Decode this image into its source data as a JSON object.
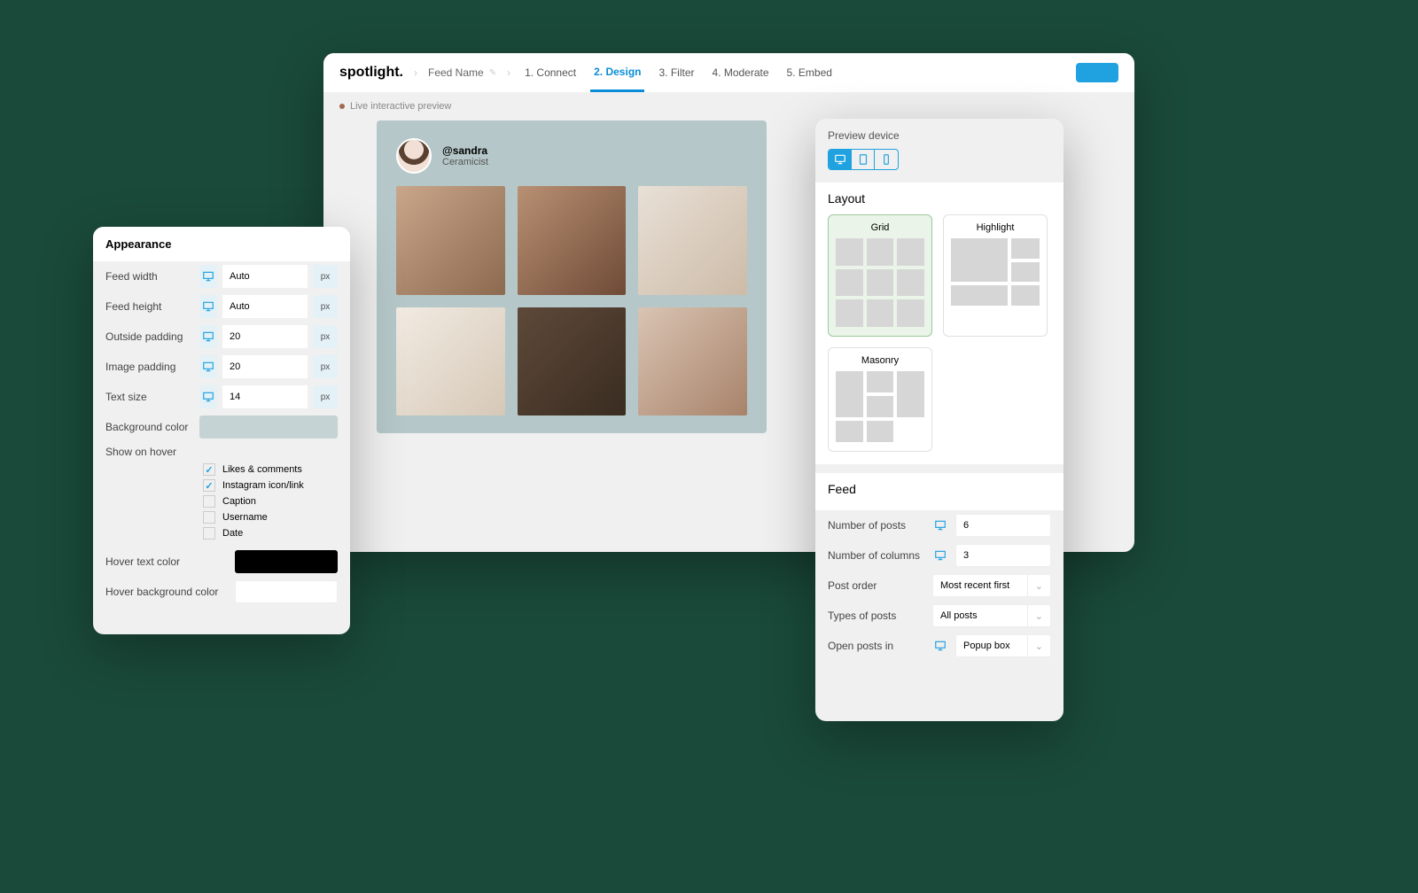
{
  "logo": "spotlight.",
  "breadcrumb": {
    "feed_name": "Feed Name"
  },
  "steps": {
    "s1": "1. Connect",
    "s2": "2. Design",
    "s3": "3. Filter",
    "s4": "4. Moderate",
    "s5": "5. Embed"
  },
  "preview_label": "Live interactive preview",
  "profile": {
    "handle": "@sandra",
    "role": "Ceramicist"
  },
  "right": {
    "preview_device_label": "Preview device",
    "layout_heading": "Layout",
    "layouts": {
      "grid": "Grid",
      "highlight": "Highlight",
      "masonry": "Masonry"
    },
    "feed_heading": "Feed",
    "fields": {
      "num_posts_label": "Number of posts",
      "num_posts_value": "6",
      "num_cols_label": "Number of columns",
      "num_cols_value": "3",
      "post_order_label": "Post order",
      "post_order_value": "Most recent first",
      "types_label": "Types of posts",
      "types_value": "All posts",
      "open_label": "Open posts in",
      "open_value": "Popup box"
    }
  },
  "appearance": {
    "heading": "Appearance",
    "feed_width_label": "Feed width",
    "feed_width_value": "Auto",
    "feed_width_unit": "px",
    "feed_height_label": "Feed height",
    "feed_height_value": "Auto",
    "feed_height_unit": "px",
    "outside_pad_label": "Outside padding",
    "outside_pad_value": "20",
    "outside_pad_unit": "px",
    "image_pad_label": "Image padding",
    "image_pad_value": "20",
    "image_pad_unit": "px",
    "text_size_label": "Text size",
    "text_size_value": "14",
    "text_size_unit": "px",
    "bg_color_label": "Background color",
    "show_hover_label": "Show on hover",
    "hover_opts": {
      "likes": "Likes & comments",
      "ig": "Instagram icon/link",
      "caption": "Caption",
      "username": "Username",
      "date": "Date"
    },
    "hover_text_label": "Hover text color",
    "hover_bg_label": "Hover background color"
  }
}
